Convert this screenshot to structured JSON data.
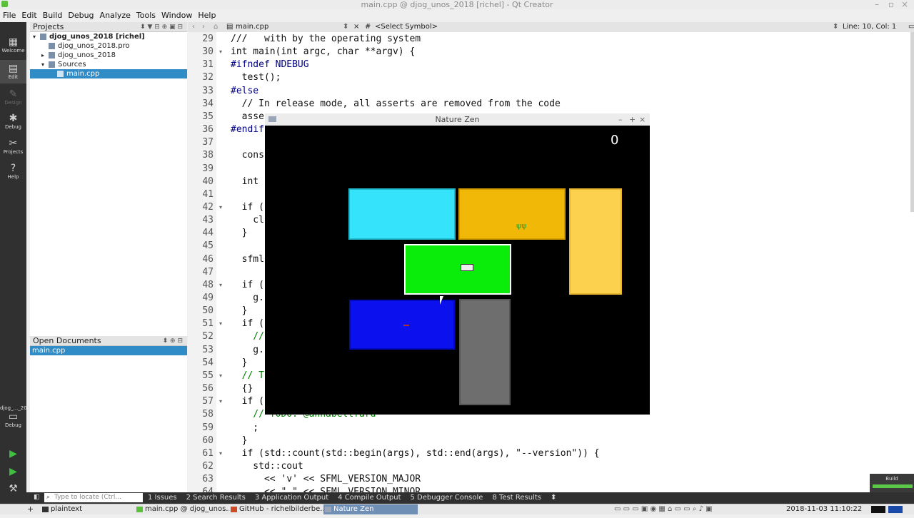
{
  "window": {
    "title": "main.cpp @ djog_unos_2018 [richel] - Qt Creator"
  },
  "menu": [
    "File",
    "Edit",
    "Build",
    "Debug",
    "Analyze",
    "Tools",
    "Window",
    "Help"
  ],
  "modes": [
    "Welcome",
    "Edit",
    "Design",
    "Debug",
    "Projects",
    "Help"
  ],
  "kit": {
    "name": "djog_..._2018",
    "mode": "Debug"
  },
  "projects": {
    "header": "Projects",
    "items": [
      {
        "label": "djog_unos_2018 [richel]",
        "bold": true,
        "indent": 0,
        "arrow": "▾"
      },
      {
        "label": "djog_unos_2018.pro",
        "indent": 1,
        "arrow": ""
      },
      {
        "label": "djog_unos_2018",
        "indent": 1,
        "arrow": "▸"
      },
      {
        "label": "Sources",
        "indent": 1,
        "arrow": "▾"
      },
      {
        "label": "main.cpp",
        "indent": 2,
        "arrow": "",
        "selected": true
      }
    ]
  },
  "open_documents": {
    "header": "Open Documents",
    "items": [
      "main.cpp"
    ]
  },
  "editor": {
    "file_tab": "main.cpp",
    "symbol": "<Select Symbol>",
    "position": "Line: 10, Col: 1",
    "lines": [
      {
        "n": "29",
        "text": "///   with by the operating system",
        "cls": ""
      },
      {
        "n": "30",
        "text": "int main(int argc, char **argv) {",
        "cls": "",
        "fold": true
      },
      {
        "n": "31",
        "text": "#ifndef NDEBUG",
        "cls": "pp"
      },
      {
        "n": "32",
        "text": "  test();",
        "cls": ""
      },
      {
        "n": "33",
        "text": "#else",
        "cls": "pp"
      },
      {
        "n": "34",
        "text": "  // In release mode, all asserts are removed from the code",
        "cls": ""
      },
      {
        "n": "35",
        "text": "  asse",
        "cls": ""
      },
      {
        "n": "36",
        "text": "#endif",
        "cls": "pp"
      },
      {
        "n": "37",
        "text": "",
        "cls": ""
      },
      {
        "n": "38",
        "text": "  cons",
        "cls": ""
      },
      {
        "n": "39",
        "text": "",
        "cls": ""
      },
      {
        "n": "40",
        "text": "  int",
        "cls": ""
      },
      {
        "n": "41",
        "text": "",
        "cls": ""
      },
      {
        "n": "42",
        "text": "  if (",
        "cls": "",
        "fold": true
      },
      {
        "n": "43",
        "text": "    cl",
        "cls": ""
      },
      {
        "n": "44",
        "text": "  }",
        "cls": ""
      },
      {
        "n": "45",
        "text": "",
        "cls": ""
      },
      {
        "n": "46",
        "text": "  sfml",
        "cls": ""
      },
      {
        "n": "47",
        "text": "",
        "cls": ""
      },
      {
        "n": "48",
        "text": "  if (",
        "cls": "",
        "fold": true
      },
      {
        "n": "49",
        "text": "    g.",
        "cls": ""
      },
      {
        "n": "50",
        "text": "  }",
        "cls": ""
      },
      {
        "n": "51",
        "text": "  if (",
        "cls": "",
        "fold": true
      },
      {
        "n": "52",
        "text": "    //",
        "cls": "cm"
      },
      {
        "n": "53",
        "text": "    g.",
        "cls": ""
      },
      {
        "n": "54",
        "text": "  }",
        "cls": ""
      },
      {
        "n": "55",
        "text": "  // T",
        "cls": "cm",
        "fold": true
      },
      {
        "n": "56",
        "text": "  {}",
        "cls": ""
      },
      {
        "n": "57",
        "text": "  if (",
        "cls": "",
        "fold": true
      },
      {
        "n": "58",
        "text": "    // TODO: @annabellfard",
        "cls": "cm"
      },
      {
        "n": "59",
        "text": "    ;",
        "cls": ""
      },
      {
        "n": "60",
        "text": "  }",
        "cls": ""
      },
      {
        "n": "61",
        "text": "  if (std::count(std::begin(args), std::end(args), \"--version\")) {",
        "cls": "",
        "fold": true
      },
      {
        "n": "62",
        "text": "    std::cout",
        "cls": ""
      },
      {
        "n": "63",
        "text": "      << 'v' << SFML_VERSION_MAJOR",
        "cls": ""
      },
      {
        "n": "64",
        "text": "      << \".\" << SFML_VERSION_MINOR",
        "cls": ""
      }
    ]
  },
  "game": {
    "title": "Nature Zen",
    "score": "0",
    "colors": {
      "cyan": "#35e4fb",
      "orange": "#f2b807",
      "yellow": "#fbd14d",
      "green": "#0aed0a",
      "blue": "#0a10ee",
      "gray": "#6e6e6e",
      "grass": "#3a9a1e"
    }
  },
  "output_tabs": [
    "1  Issues",
    "2  Search Results",
    "3  Application Output",
    "4  Compile Output",
    "5  Debugger Console",
    "8  Test Results"
  ],
  "locator_placeholder": "Type to locate (Ctrl...",
  "build_label": "Build",
  "taskbar": {
    "items": [
      "plaintext",
      "main.cpp @ djog_unos...",
      "GitHub - richelbilderbe...",
      "Nature Zen"
    ],
    "clock": "2018-11-03   11:10:22"
  }
}
